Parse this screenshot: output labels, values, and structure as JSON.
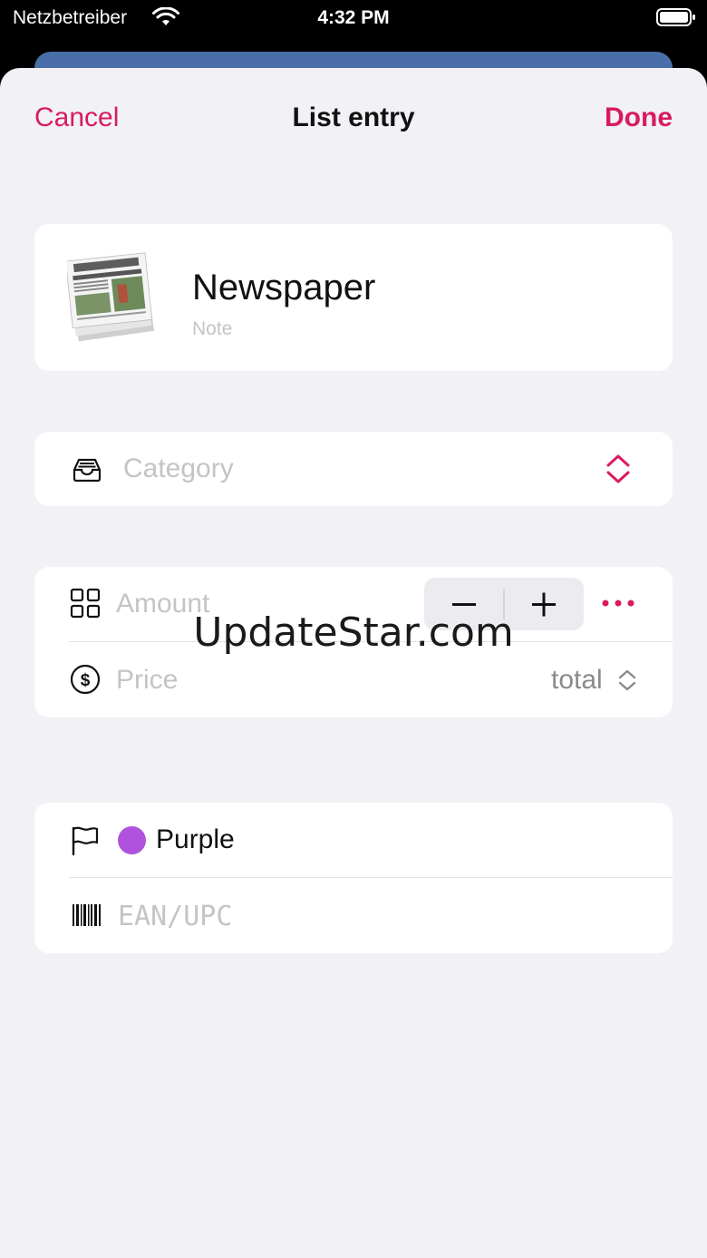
{
  "status_bar": {
    "carrier": "Netzbetreiber",
    "time": "4:32 PM"
  },
  "nav": {
    "cancel_label": "Cancel",
    "title": "List entry",
    "done_label": "Done"
  },
  "item": {
    "name": "Newspaper",
    "note_placeholder": "Note",
    "image_icon": "newspaper-image"
  },
  "category": {
    "placeholder": "Category",
    "icon": "tray-icon"
  },
  "amount": {
    "placeholder": "Amount",
    "icon": "grid-icon",
    "stepper_minus": "−",
    "stepper_plus": "+"
  },
  "price": {
    "placeholder": "Price",
    "icon": "dollar-circle-icon",
    "mode": "total"
  },
  "color": {
    "label": "Purple",
    "value": "#af52de",
    "icon": "flag-icon"
  },
  "barcode": {
    "placeholder": "EAN/UPC",
    "icon": "barcode-icon"
  },
  "watermark": "UpdateStar.com",
  "colors": {
    "accent": "#d81b60",
    "background": "#f1f1f6",
    "card": "#ffffff",
    "placeholder": "#c4c4c8"
  }
}
